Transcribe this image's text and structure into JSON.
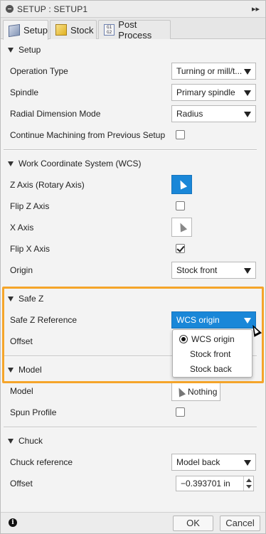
{
  "titlebar": {
    "title": "SETUP : SETUP1"
  },
  "tabs": [
    {
      "label": "Setup",
      "active": true
    },
    {
      "label": "Stock",
      "active": false
    },
    {
      "label": "Post Process",
      "active": false
    }
  ],
  "post_icon_text": "G1 G2",
  "setup": {
    "heading": "Setup",
    "operation_type_label": "Operation Type",
    "operation_type_value": "Turning or mill/t...",
    "spindle_label": "Spindle",
    "spindle_value": "Primary spindle",
    "radial_label": "Radial Dimension Mode",
    "radial_value": "Radius",
    "continue_label": "Continue Machining from Previous Setup",
    "continue_checked": false
  },
  "wcs": {
    "heading": "Work Coordinate System (WCS)",
    "z_axis_label": "Z Axis (Rotary Axis)",
    "flip_z_label": "Flip Z Axis",
    "flip_z_checked": false,
    "x_axis_label": "X Axis",
    "flip_x_label": "Flip X Axis",
    "flip_x_checked": true,
    "origin_label": "Origin",
    "origin_value": "Stock front"
  },
  "safe_z": {
    "heading": "Safe Z",
    "reference_label": "Safe Z Reference",
    "reference_value": "WCS origin",
    "offset_label": "Offset",
    "menu_options": [
      "WCS origin",
      "Stock front",
      "Stock back"
    ],
    "menu_selected": "WCS origin"
  },
  "model": {
    "heading": "Model",
    "model_label": "Model",
    "model_button": "Nothing",
    "spun_label": "Spun Profile",
    "spun_checked": false
  },
  "chuck": {
    "heading": "Chuck",
    "reference_label": "Chuck reference",
    "reference_value": "Model back",
    "offset_label": "Offset",
    "offset_value": "−0.393701 in"
  },
  "footer": {
    "ok_label": "OK",
    "cancel_label": "Cancel",
    "info_glyph": "i"
  },
  "colors": {
    "accent": "#1a87d8",
    "highlight": "#f5a52a"
  }
}
